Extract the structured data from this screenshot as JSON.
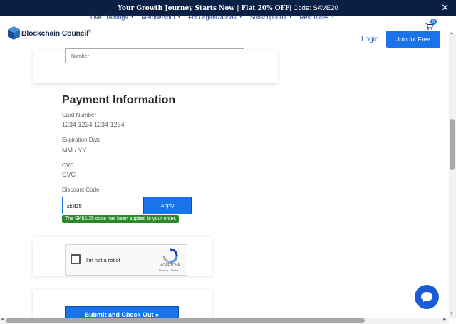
{
  "promo": {
    "text_bold": "Your Growth Journey Starts Now | Flat 20% OFF",
    "text_code": " | Code: SAVE20",
    "close": "✕"
  },
  "nav": {
    "logo": "Blockchain Council",
    "logo_mark": "®",
    "menu": [
      {
        "label": "Live Trainings"
      },
      {
        "label": "Membership"
      },
      {
        "label": "For Organizations"
      },
      {
        "label": "Subscriptions"
      },
      {
        "label": "Resources"
      }
    ],
    "cart_count": "0",
    "login": "Login",
    "join": "Join for Free"
  },
  "form": {
    "number_placeholder": "Number",
    "payment_title": "Payment Information",
    "card_number_label": "Card Number",
    "card_number_placeholder": "1234 1234 1234 1234",
    "expiration_label": "Expiration Date",
    "expiration_placeholder": "MM / YY",
    "cvc_label": "CVC",
    "cvc_placeholder": "CVC",
    "discount_label": "Discount Code",
    "discount_value": "skill35",
    "apply": "Apply",
    "applied_message": "The SKILL35 code has been applied to your order.",
    "submit": "Submit and Check Out »"
  },
  "captcha": {
    "label": "I'm not a robot",
    "brand": "reCAPTCHA",
    "links": "Privacy - Terms"
  },
  "colors": {
    "primary": "#1a73e8",
    "promo_bg": "#0a1f44",
    "success": "#2a8a2a"
  }
}
